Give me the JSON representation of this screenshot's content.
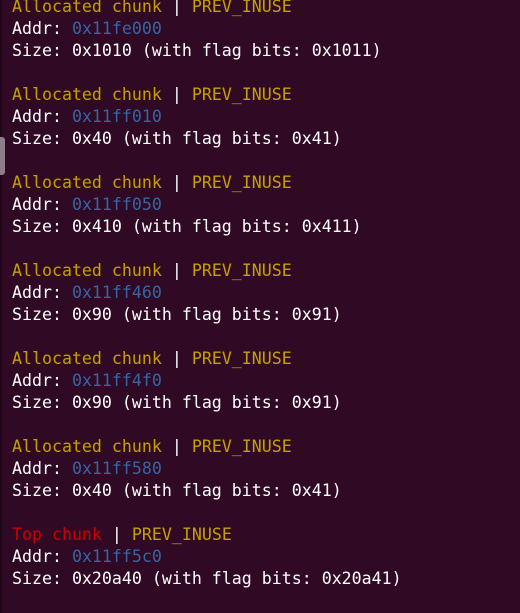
{
  "terminal": {
    "separator": " | ",
    "addr_label": "Addr: ",
    "chunks": [
      {
        "type": "Allocated chunk",
        "flag": "PREV_INUSE",
        "addr": "0x11fe000",
        "size_line": "Size: 0x1010 (with flag bits: 0x1011)"
      },
      {
        "type": "Allocated chunk",
        "flag": "PREV_INUSE",
        "addr": "0x11ff010",
        "size_line": "Size: 0x40 (with flag bits: 0x41)"
      },
      {
        "type": "Allocated chunk",
        "flag": "PREV_INUSE",
        "addr": "0x11ff050",
        "size_line": "Size: 0x410 (with flag bits: 0x411)"
      },
      {
        "type": "Allocated chunk",
        "flag": "PREV_INUSE",
        "addr": "0x11ff460",
        "size_line": "Size: 0x90 (with flag bits: 0x91)"
      },
      {
        "type": "Allocated chunk",
        "flag": "PREV_INUSE",
        "addr": "0x11ff4f0",
        "size_line": "Size: 0x90 (with flag bits: 0x91)"
      },
      {
        "type": "Allocated chunk",
        "flag": "PREV_INUSE",
        "addr": "0x11ff580",
        "size_line": "Size: 0x40 (with flag bits: 0x41)"
      },
      {
        "type": "Top chunk",
        "flag": "PREV_INUSE",
        "addr": "0x11ff5c0",
        "size_line": "Size: 0x20a40 (with flag bits: 0x20a41)"
      }
    ]
  },
  "colors": {
    "background": "#300a24",
    "allocated": "#c4a000",
    "top": "#cc0000",
    "address": "#3465a4",
    "text": "#ffffff"
  }
}
